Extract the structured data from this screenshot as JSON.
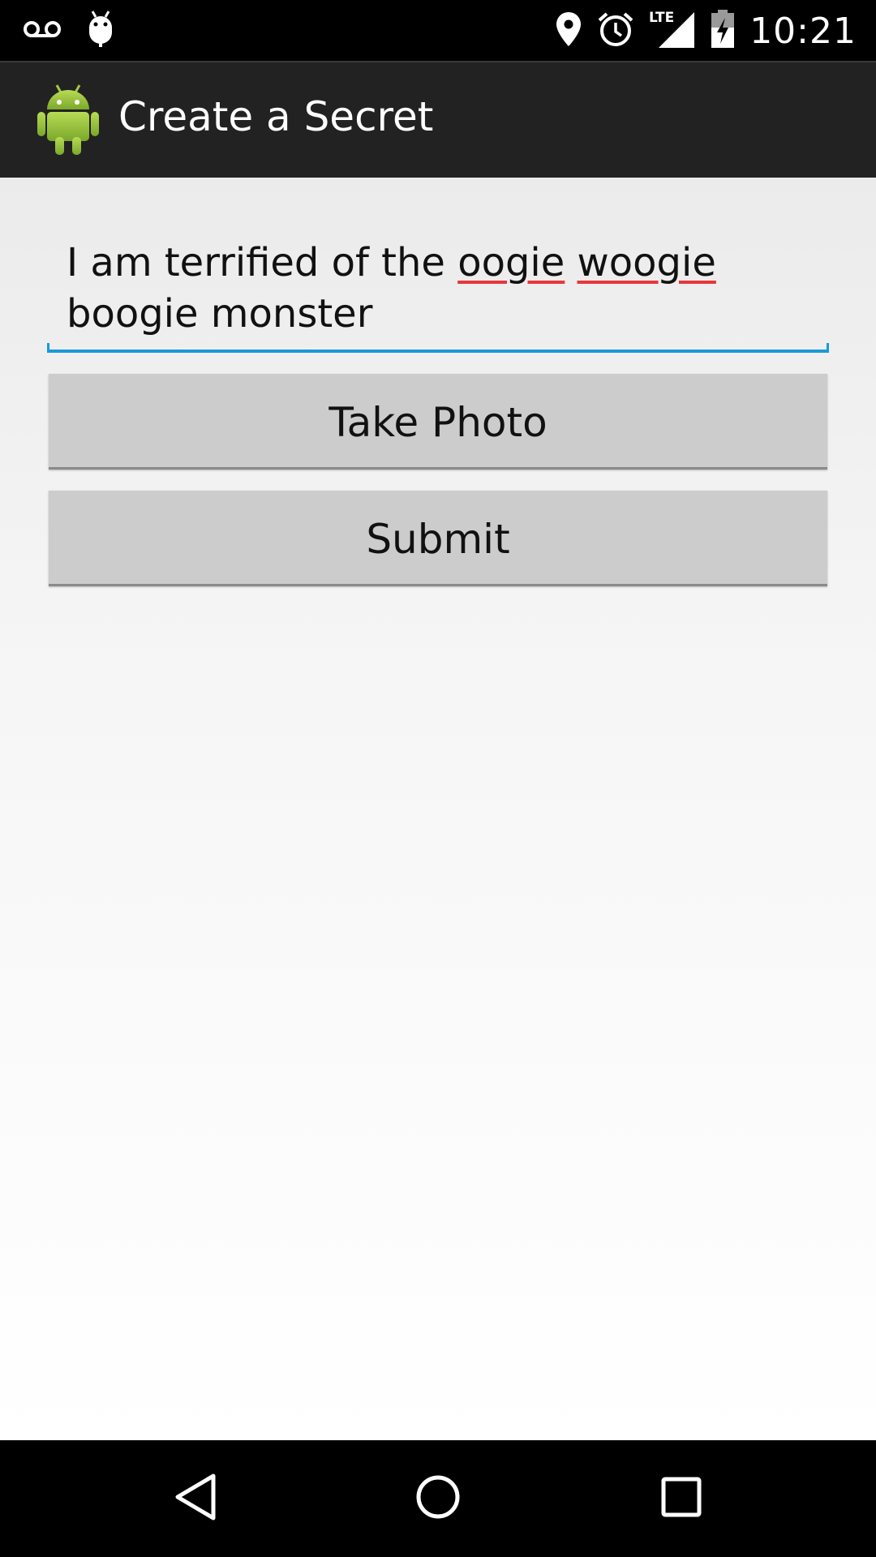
{
  "status_bar": {
    "time": "10:21",
    "network_label": "LTE",
    "icons": [
      "voicemail-icon",
      "android-debug-icon",
      "location-icon",
      "alarm-icon",
      "signal-icon",
      "battery-charging-icon"
    ]
  },
  "action_bar": {
    "title": "Create a Secret",
    "app_icon": "android-robot-icon",
    "colors": {
      "background": "#222222",
      "icon_green": "#9bc73a"
    }
  },
  "form": {
    "secret_text_parts": {
      "part1": "I am terrified of the ",
      "word_oogie": "oogie",
      "space": " ",
      "word_woogie": "woogie",
      "part2": " boogie monster"
    },
    "spellcheck_flagged": [
      "oogie",
      "woogie"
    ],
    "take_photo_label": "Take Photo",
    "submit_label": "Submit",
    "colors": {
      "input_underline": "#1a9ad9",
      "spell_error": "#e8363a",
      "button": "#cccccc"
    }
  },
  "nav_bar": {
    "icons": [
      "back-icon",
      "home-icon",
      "recent-apps-icon"
    ]
  }
}
